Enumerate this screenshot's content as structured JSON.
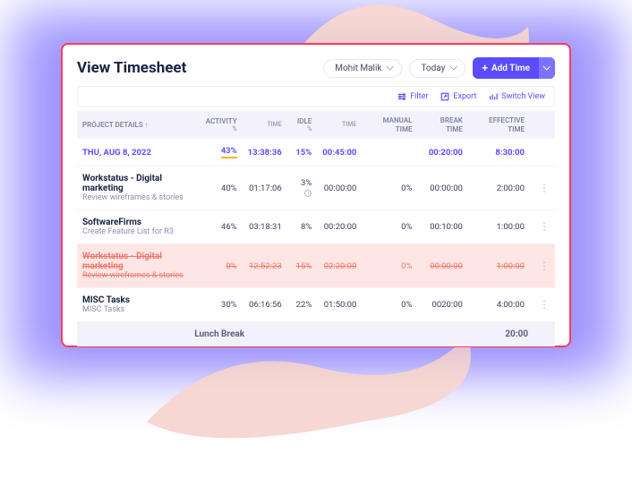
{
  "header": {
    "title": "View Timesheet",
    "user_select": "Mohit Malik",
    "period_select": "Today",
    "add_button": "Add Time"
  },
  "toolbar": {
    "filter": "Filter",
    "export": "Export",
    "switch": "Switch View"
  },
  "columns": {
    "project": "PROJECT DETAILS",
    "activity": "ACTIVITY",
    "activity_pct": "%",
    "activity_time": "TIME",
    "idle": "IDLE",
    "idle_pct": "%",
    "idle_time": "TIME",
    "manual": "MANUAL TIME",
    "break": "BREAK TIME",
    "effective": "EFFECTIVE TIME"
  },
  "summary": {
    "date": "THU, AUG 8, 2022",
    "activity_pct": "43%",
    "activity_time": "13:38:36",
    "idle_pct": "15%",
    "idle_time": "00:45:00",
    "manual": "",
    "break": "00:20:00",
    "effective": "8:30:00"
  },
  "rows": [
    {
      "project": "Workstatus - Digital marketing",
      "task": "Review wireframes & stories",
      "activity_pct": "40%",
      "activity_time": "01:17:06",
      "idle_pct": "3%",
      "idle_info": true,
      "idle_time": "00:00:00",
      "manual": "0%",
      "break": "00:00:00",
      "effective": "2:00:00",
      "deleted": false
    },
    {
      "project": "SoftwareFirms",
      "task": "Create Feature List for R3",
      "activity_pct": "46%",
      "activity_time": "03:18:31",
      "idle_pct": "8%",
      "idle_info": false,
      "idle_time": "00:20:00",
      "manual": "0%",
      "break": "00:10:00",
      "effective": "1:00:00",
      "deleted": false
    },
    {
      "project": "Workstatus - Digital marketing",
      "task": "Review wireframes & stories",
      "activity_pct": "0%",
      "activity_time": "12:52:23",
      "idle_pct": "15%",
      "idle_info": false,
      "idle_time": "02:20:00",
      "manual": "0%",
      "break": "00:00:00",
      "effective": "1:00:00",
      "deleted": true
    },
    {
      "project": "MISC Tasks",
      "task": "MISC Tasks",
      "activity_pct": "30%",
      "activity_time": "06:16:56",
      "idle_pct": "22%",
      "idle_info": false,
      "idle_time": "01:50:00",
      "manual": "0%",
      "break": "0020:00",
      "effective": "4:00:00",
      "deleted": false
    }
  ],
  "footer": {
    "label": "Lunch Break",
    "value": "20:00"
  }
}
